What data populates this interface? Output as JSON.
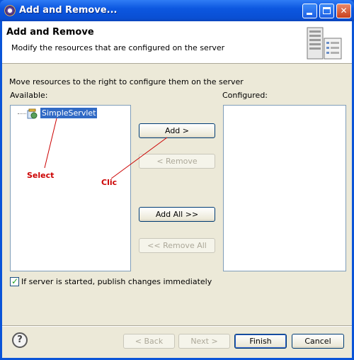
{
  "window": {
    "title": "Add and Remove...",
    "icon": "eclipse-gear-icon"
  },
  "header": {
    "title": "Add and Remove",
    "description": "Modify the resources that are configured on the server",
    "icon": "server-icon"
  },
  "main": {
    "instruction": "Move resources to the right to configure them on the server",
    "available_label": "Available:",
    "configured_label": "Configured:",
    "available_items": [
      {
        "label": "SimpleServlet",
        "icon": "web-project-icon",
        "selected": true
      }
    ],
    "configured_items": []
  },
  "buttons": {
    "add": "Add >",
    "remove": "< Remove",
    "add_all": "Add All >>",
    "remove_all": "<< Remove All"
  },
  "annotations": {
    "select": "Select",
    "click": "Clic",
    "color": "#cc0000"
  },
  "options": {
    "publish_checkbox_label": "If server is started, publish changes immediately",
    "publish_checked": true
  },
  "footer": {
    "help": "?",
    "back": "< Back",
    "next": "Next >",
    "finish": "Finish",
    "cancel": "Cancel"
  }
}
